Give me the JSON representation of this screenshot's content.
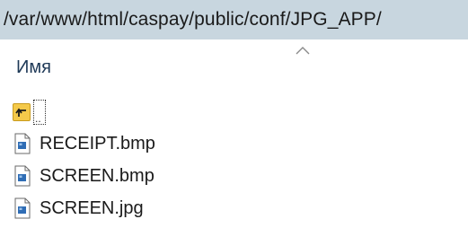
{
  "path_bar": {
    "path": "/var/www/html/caspay/public/conf/JPG_APP/"
  },
  "columns": {
    "name_header": "Имя"
  },
  "up_entry": {
    "label": ".."
  },
  "files": [
    {
      "name": "RECEIPT.bmp",
      "icon": "image-file-icon"
    },
    {
      "name": "SCREEN.bmp",
      "icon": "image-file-icon"
    },
    {
      "name": "SCREEN.jpg",
      "icon": "image-file-icon"
    }
  ],
  "colors": {
    "path_bar_bg": "#c8d6df",
    "header_text": "#1e3957",
    "folder_yellow": "#f4c94a",
    "icon_blue": "#2f6db5"
  }
}
